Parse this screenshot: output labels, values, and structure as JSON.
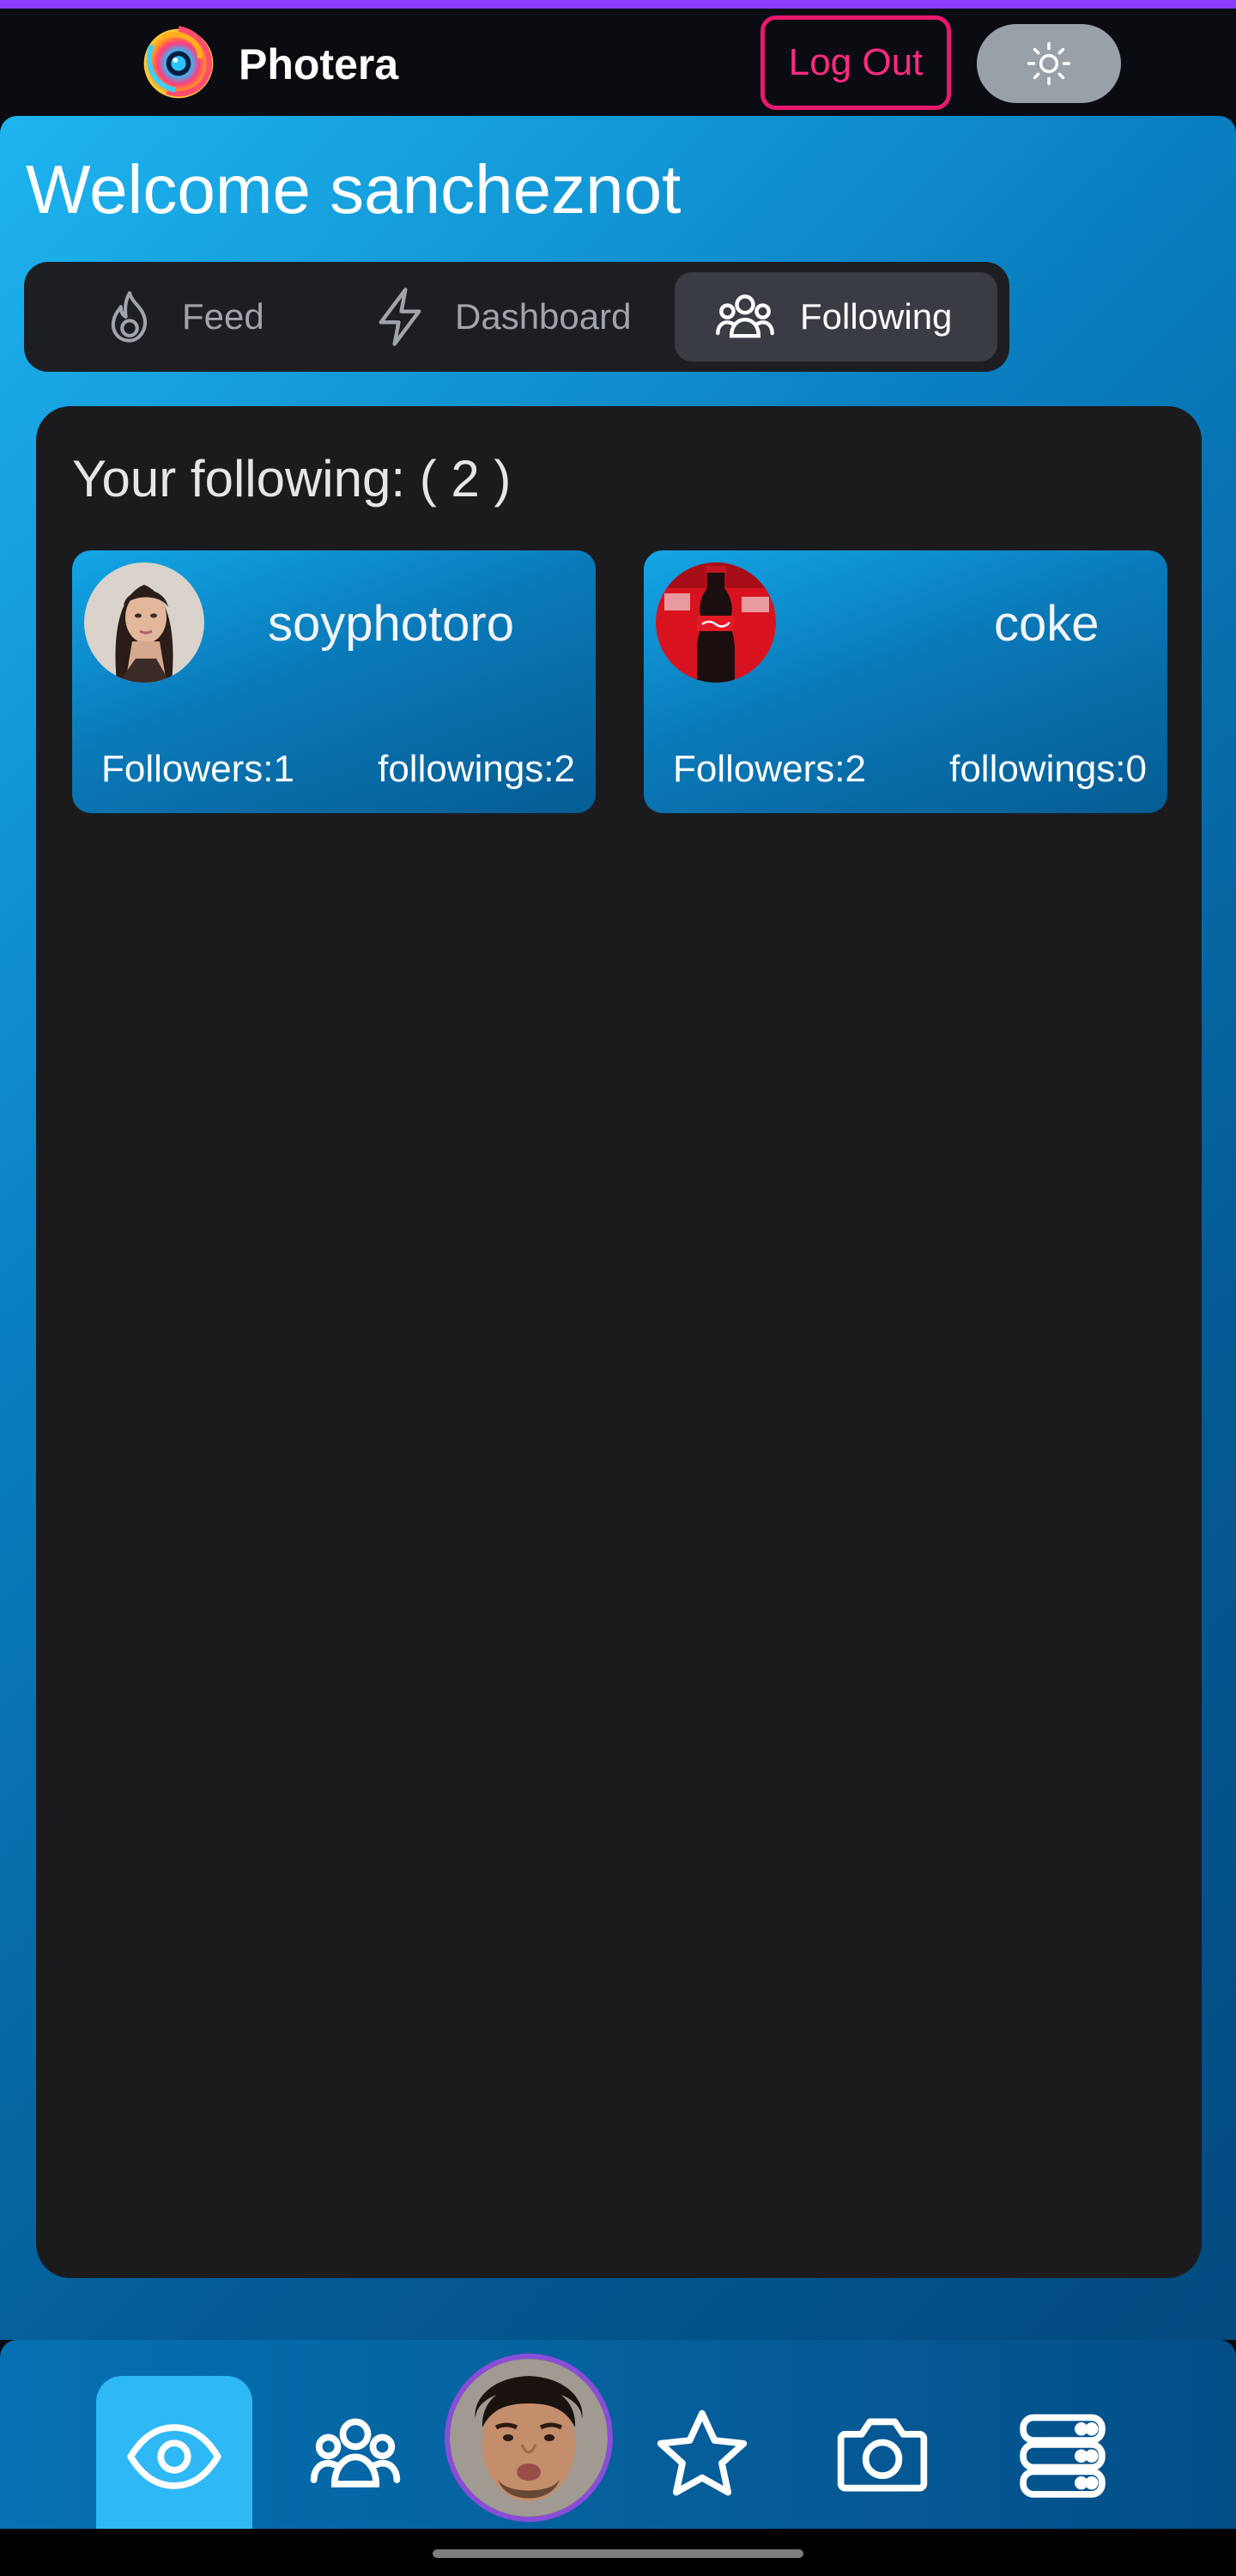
{
  "header": {
    "app_title": "Photera",
    "logout_label": "Log Out",
    "theme_toggle_icon": "sun-icon"
  },
  "main": {
    "welcome_text": "Welcome sancheznot",
    "tabs": [
      {
        "label": "Feed",
        "icon": "flame-icon",
        "active": false
      },
      {
        "label": "Dashboard",
        "icon": "lightning-icon",
        "active": false
      },
      {
        "label": "Following",
        "icon": "users-icon",
        "active": true
      }
    ],
    "following_title": "Your following: ( 2 )",
    "users": [
      {
        "username": "soyphotoro",
        "followers": "Followers:1",
        "followings": "followings:2",
        "avatar": "woman-portrait"
      },
      {
        "username": "coke",
        "followers": "Followers:2",
        "followings": "followings:0",
        "avatar": "coca-cola-bottle"
      }
    ]
  },
  "bottom_nav": {
    "items": [
      {
        "icon": "eye-icon",
        "active": true
      },
      {
        "icon": "users-icon",
        "active": false
      },
      {
        "icon": "profile-avatar",
        "active": false
      },
      {
        "icon": "star-icon",
        "active": false
      },
      {
        "icon": "camera-icon",
        "active": false
      },
      {
        "icon": "server-icon",
        "active": false
      }
    ]
  },
  "colors": {
    "accent_bar": "#8b3dff",
    "logout": "#e8196e",
    "active_nav": "#2eb8f5",
    "card_bg": "#1b1b1e"
  }
}
